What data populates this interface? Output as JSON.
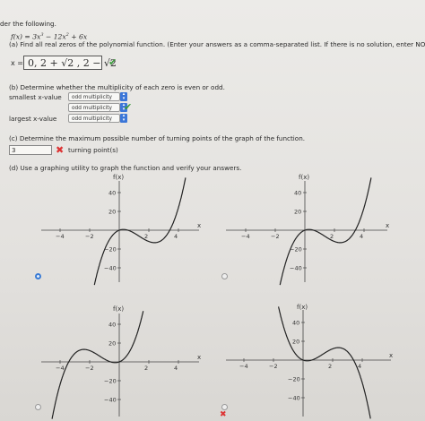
{
  "header": {
    "intro": "der the following."
  },
  "function_text": {
    "lhs": "f(x) = 3x",
    "exp1": "3",
    "mid": " − 12x",
    "exp2": "2",
    "end": " + 6x"
  },
  "part_a": {
    "prompt": "(a) Find all real zeros of the polynomial function. (Enter your answers as a comma-separated list. If there is no solution, enter NO SOLUTIO",
    "x_label": "x =",
    "answer": "0, 2 + √2 , 2 − √2",
    "status": "correct"
  },
  "part_b": {
    "prompt": "(b) Determine whether the multiplicity of each zero is even or odd.",
    "rows": [
      {
        "label": "smallest x-value",
        "value": "odd multiplicity"
      },
      {
        "label": "",
        "value": "odd multiplicity"
      },
      {
        "label": "largest x-value",
        "value": "odd multiplicity"
      }
    ],
    "status": "correct"
  },
  "part_c": {
    "prompt": "(c) Determine the maximum possible number of turning points of the graph of the function.",
    "answer": "3",
    "unit": "turning point(s)",
    "status": "incorrect"
  },
  "part_d": {
    "prompt": "(d) Use a graphing utility to graph the function and verify your answers.",
    "graph_axis_label": "f(x)",
    "x_label": "x",
    "graphs": [
      {
        "name": "graph-top-left",
        "selected": true,
        "status": ""
      },
      {
        "name": "graph-top-right",
        "selected": false,
        "status": ""
      },
      {
        "name": "graph-bottom-left",
        "selected": false,
        "status": ""
      },
      {
        "name": "graph-bottom-right",
        "selected": false,
        "status": "incorrect"
      }
    ],
    "x_ticks": [
      "−4",
      "−2",
      "2",
      "4"
    ],
    "y_ticks": [
      "40",
      "20",
      "−20",
      "−40"
    ]
  },
  "colors": {
    "check": "#3c9a3c",
    "cross": "#dd3333",
    "select_button": "#3b76d8"
  },
  "icons": {
    "correct": "check-icon",
    "incorrect": "x-icon"
  }
}
